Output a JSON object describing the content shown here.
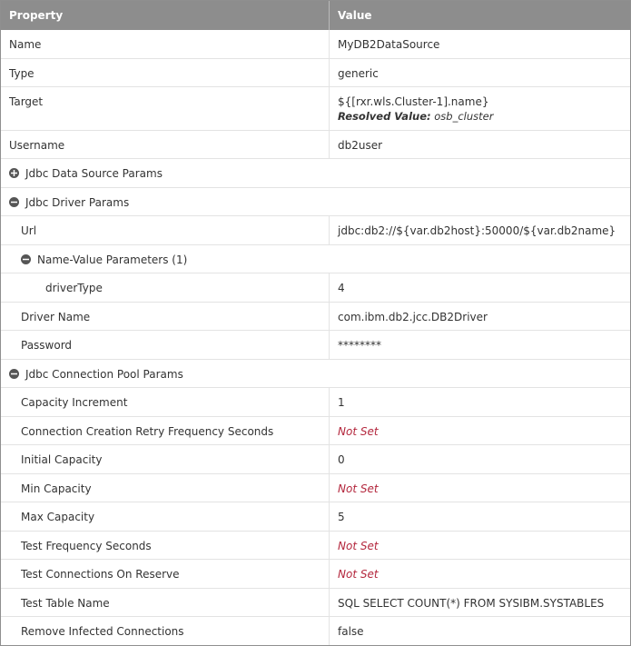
{
  "header": {
    "property": "Property",
    "value": "Value"
  },
  "rows": [
    {
      "label": "Name",
      "value": "MyDB2DataSource"
    },
    {
      "label": "Type",
      "value": "generic"
    },
    {
      "label": "Target",
      "value": "${[rxr.wls.Cluster-1].name}",
      "resolved_label": "Resolved Value:",
      "resolved_value": "osb_cluster"
    },
    {
      "label": "Username",
      "value": "db2user"
    },
    {
      "label": "Jdbc Data Source Params"
    },
    {
      "label": "Jdbc Driver Params"
    },
    {
      "label": "Url",
      "value": "jdbc:db2://${var.db2host}:50000/${var.db2name}"
    },
    {
      "label": "Name-Value Parameters (1)"
    },
    {
      "label": "driverType",
      "value": "4"
    },
    {
      "label": "Driver Name",
      "value": "com.ibm.db2.jcc.DB2Driver"
    },
    {
      "label": "Password",
      "value": "********"
    },
    {
      "label": "Jdbc Connection Pool Params"
    },
    {
      "label": "Capacity Increment",
      "value": "1"
    },
    {
      "label": "Connection Creation Retry Frequency Seconds",
      "value": "Not Set"
    },
    {
      "label": "Initial Capacity",
      "value": "0"
    },
    {
      "label": "Min Capacity",
      "value": "Not Set"
    },
    {
      "label": "Max Capacity",
      "value": "5"
    },
    {
      "label": "Test Frequency Seconds",
      "value": "Not Set"
    },
    {
      "label": "Test Connections On Reserve",
      "value": "Not Set"
    },
    {
      "label": "Test Table Name",
      "value": "SQL SELECT COUNT(*) FROM SYSIBM.SYSTABLES"
    },
    {
      "label": "Remove Infected Connections",
      "value": "false"
    }
  ],
  "icons": {
    "expand": "plus-circle-icon",
    "collapse": "minus-circle-icon"
  },
  "colors": {
    "header_bg": "#8d8d8d",
    "not_set": "#b3263c",
    "grid": "#e3e3e3"
  }
}
